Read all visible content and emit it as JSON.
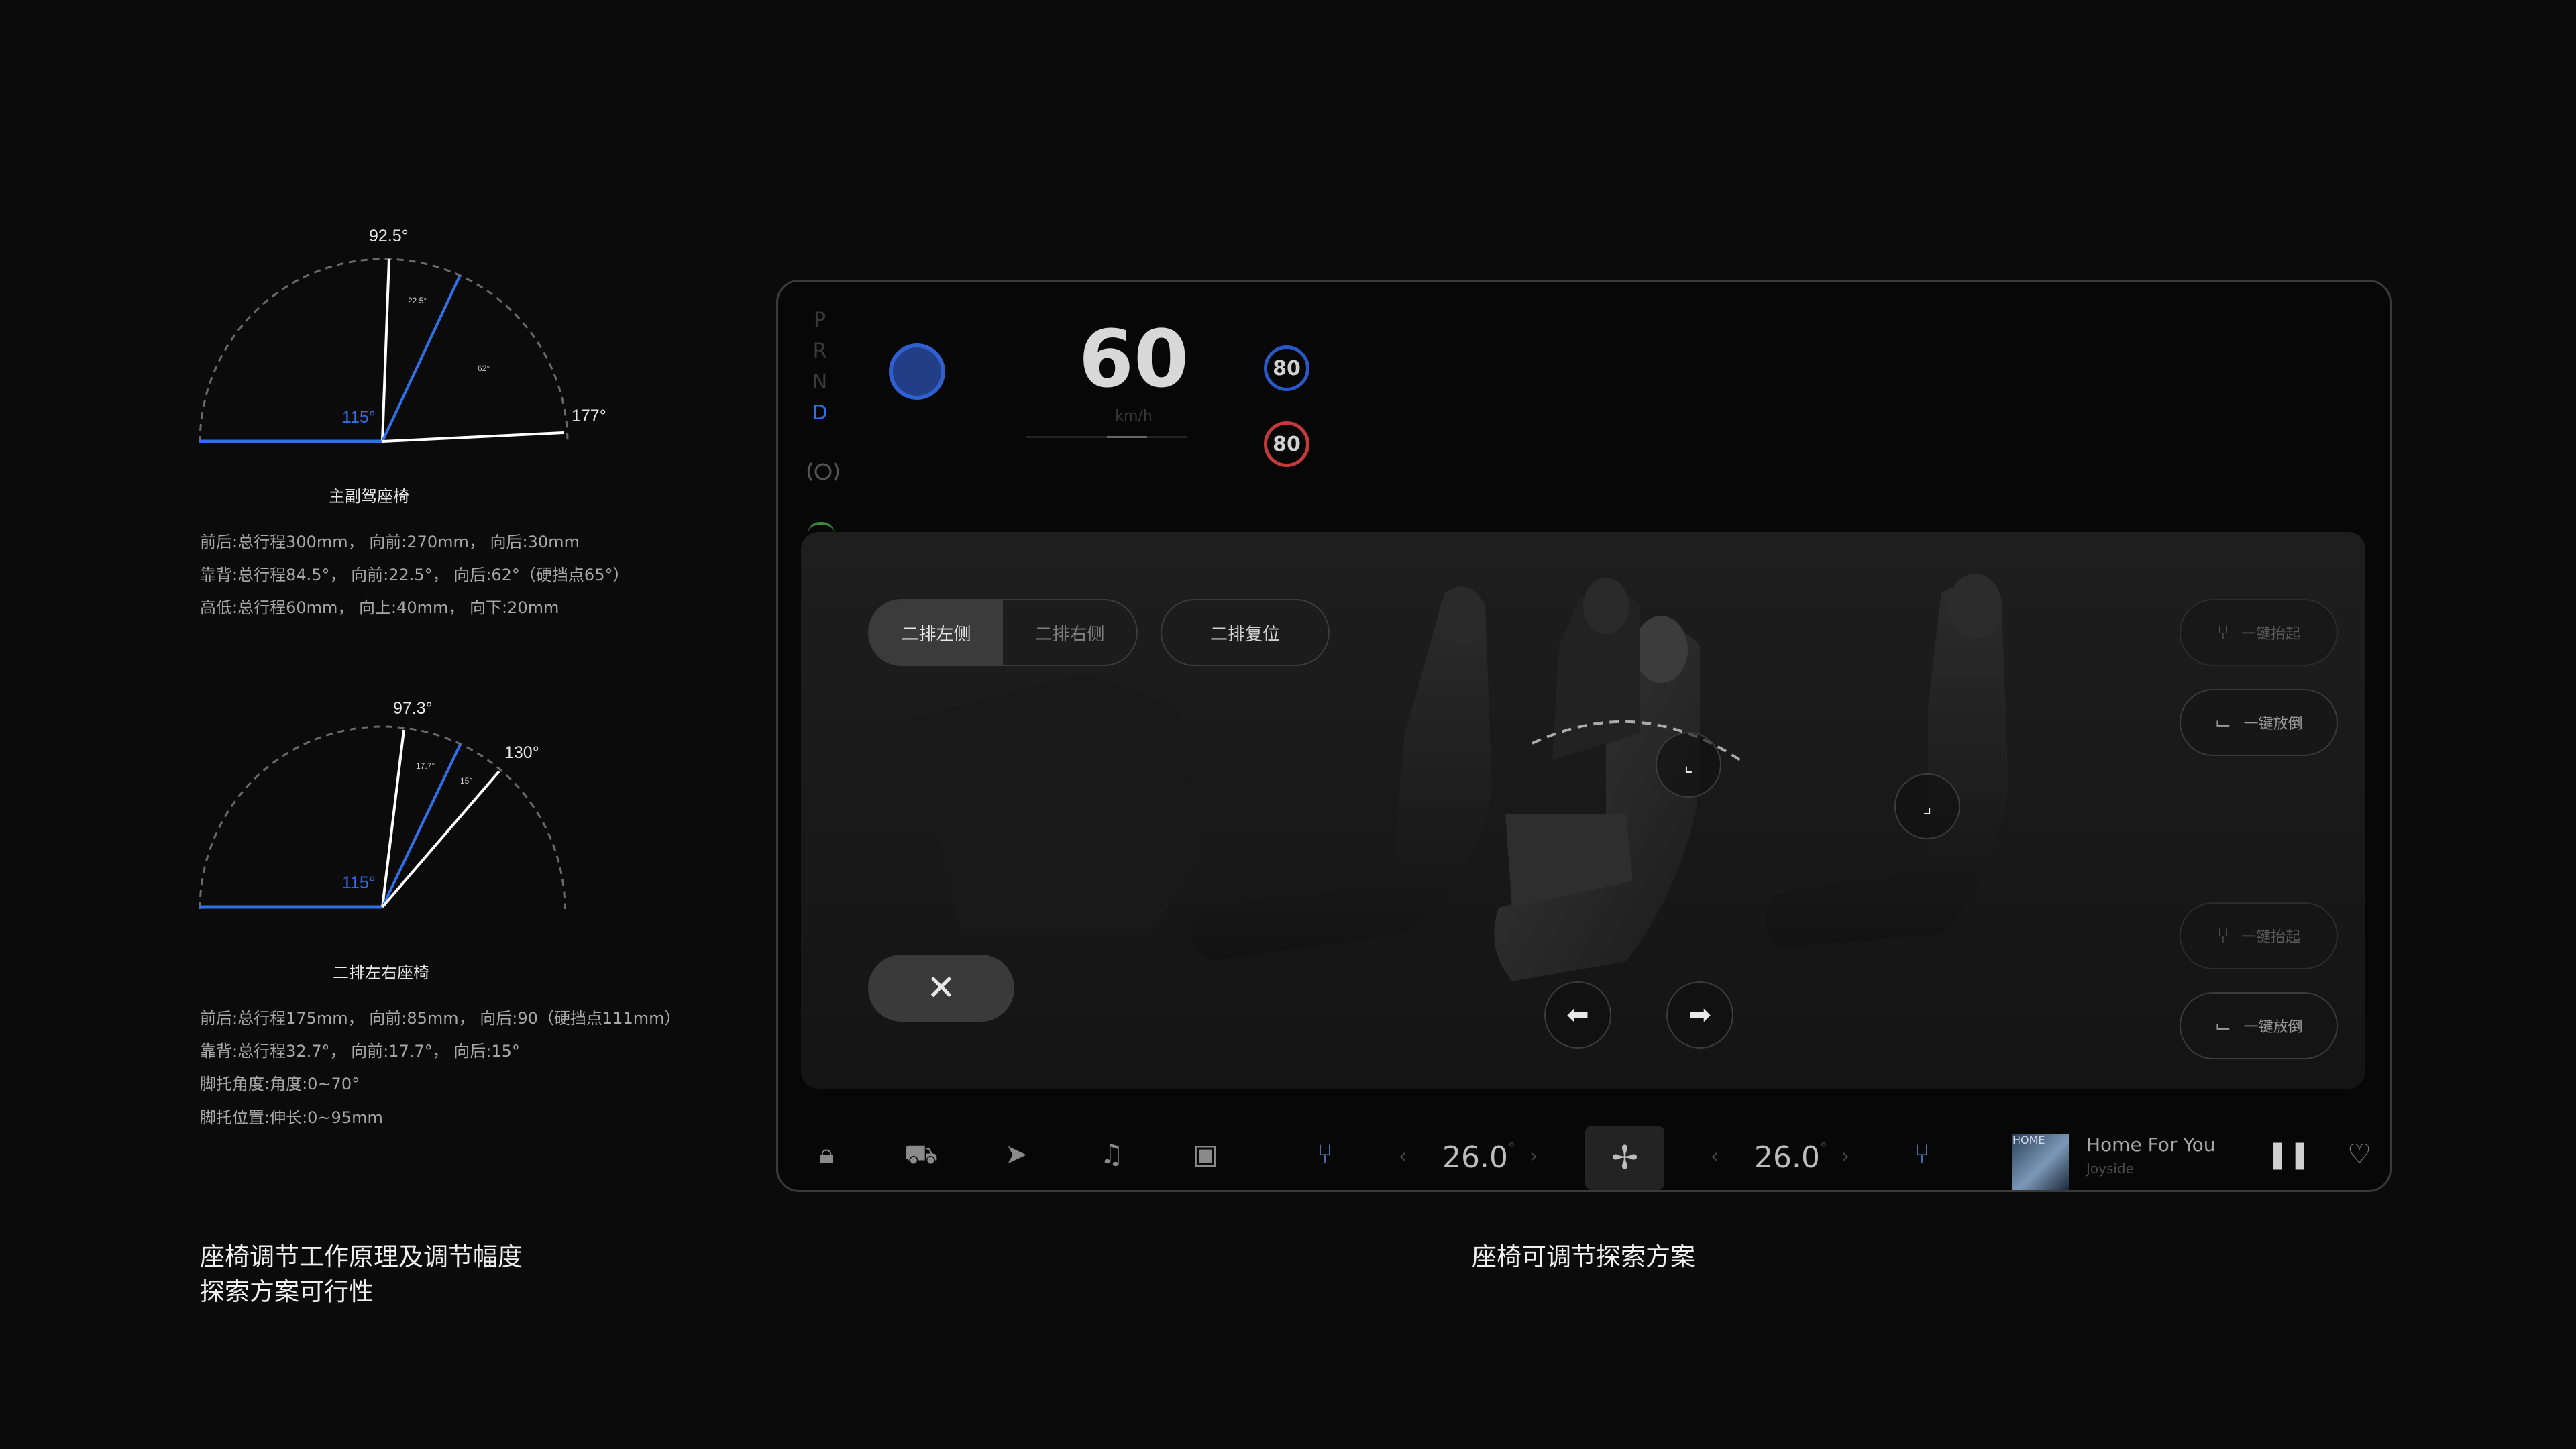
{
  "diagram_top": {
    "angle_top": "92.5°",
    "angle_mid": "22.5°",
    "angle_right_inner": "62°",
    "angle_right": "177°",
    "angle_left": "115°",
    "title": "主副驾座椅",
    "specs": [
      "前后:总行程300mm， 向前:270mm， 向后:30mm",
      "靠背:总行程84.5°， 向前:22.5°， 向后:62°（硬挡点65°）",
      "高低:总行程60mm， 向上:40mm， 向下:20mm"
    ]
  },
  "diagram_bottom": {
    "angle_top": "97.3°",
    "angle_mid": "17.7°",
    "angle_inner": "15°",
    "angle_right": "130°",
    "angle_left": "115°",
    "title": "二排左右座椅",
    "specs": [
      "前后:总行程175mm， 向前:85mm， 向后:90（硬挡点111mm）",
      "靠背:总行程32.7°， 向前:17.7°， 向后:15°",
      "脚托角度:角度:0~70°",
      "脚托位置:伸长:0~95mm"
    ]
  },
  "captions": {
    "left_line1": "座椅调节工作原理及调节幅度",
    "left_line2": "探索方案可行性",
    "right": "座椅可调节探索方案"
  },
  "screen": {
    "gears": [
      "P",
      "R",
      "N",
      "D"
    ],
    "active_gear": "D",
    "speed": "60",
    "speed_unit": "km/h",
    "speed_limit_blue": "80",
    "speed_limit_red": "80",
    "colors": {
      "accent_blue": "#2f6fe8",
      "limit_blue": "#2a57c8",
      "limit_red": "#c43a3a"
    },
    "seat_panel": {
      "tabs": [
        "二排左侧",
        "二排右侧"
      ],
      "active_tab": "二排左侧",
      "reset_button": "二排复位",
      "side_buttons": [
        "一键抬起",
        "一键放倒",
        "一键抬起",
        "一键放倒"
      ],
      "close_glyph": "✕"
    },
    "dock": {
      "temp_left": "26.0",
      "temp_right": "26.0",
      "temp_unit": "°",
      "album_art_text": "HOME",
      "song_title": "Home For You",
      "artist": "Joyside"
    }
  }
}
